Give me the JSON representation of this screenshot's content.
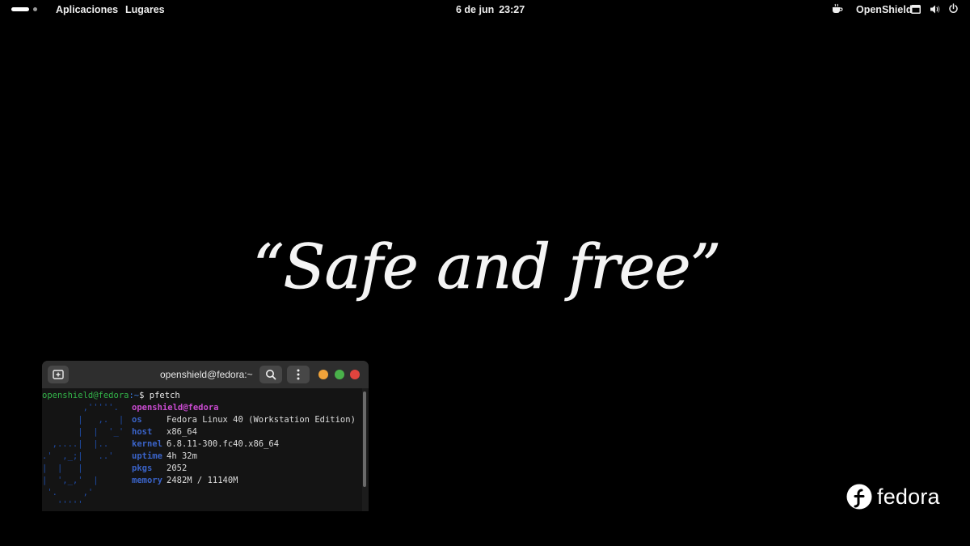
{
  "topbar": {
    "activities": "Aplicaciones",
    "places": "Lugares",
    "date": "6 de jun",
    "time": "23:27",
    "user": "OpenShield",
    "icons": [
      "workspace-indicator",
      "coffee-icon",
      "network-icon",
      "volume-icon",
      "power-icon"
    ]
  },
  "wallpaper": {
    "quote": "“Safe and free”",
    "background_color": "#000000"
  },
  "logo": {
    "brand": "fedora"
  },
  "terminal": {
    "title": "openshield@fedora:~",
    "prompt_user_host": "openshield@fedora",
    "prompt_path": ":~",
    "prompt_symbol": "$",
    "command": "pfetch",
    "header": "openshield@fedora",
    "rows": [
      {
        "label": "os",
        "value": "Fedora Linux 40 (Workstation Edition)"
      },
      {
        "label": "host",
        "value": "x86_64"
      },
      {
        "label": "kernel",
        "value": "6.8.11-300.fc40.x86_64"
      },
      {
        "label": "uptime",
        "value": "4h 32m"
      },
      {
        "label": "pkgs",
        "value": "2052"
      },
      {
        "label": "memory",
        "value": "2482M / 11140M"
      }
    ],
    "ascii_art": [
      "        ,'''''.",
      "       |   ,.  |",
      "       |  |  '_'",
      "  ,....|  |..",
      ".'  ,_;|   ..'",
      "|  |   |",
      "|  ',_,'  |",
      " '.     ,'",
      "   '''''"
    ],
    "colors": {
      "prompt_user": "#33b449",
      "prompt_path": "#3a7be0",
      "header": "#c94bd0",
      "label": "#3a63c8",
      "art": "#1f4ca8"
    }
  }
}
